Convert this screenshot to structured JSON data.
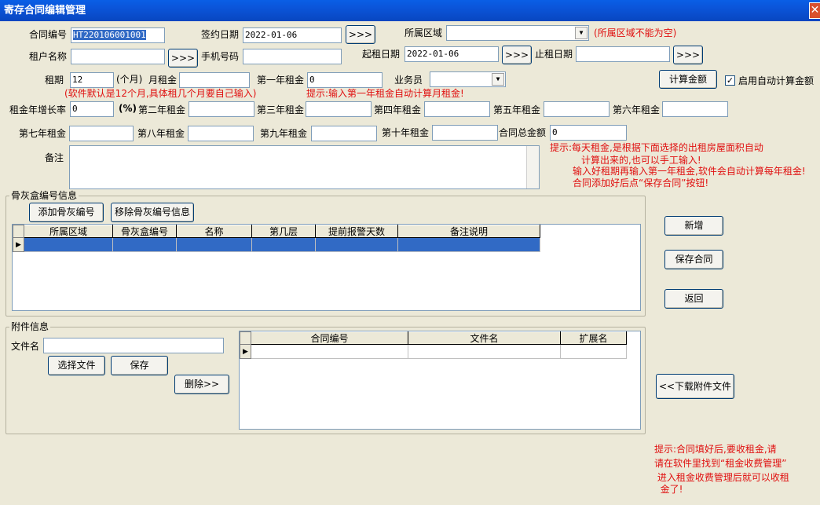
{
  "window": {
    "title": "寄存合同编辑管理",
    "close_glyph": "✕"
  },
  "form": {
    "contract_no_label": "合同编号",
    "contract_no_value": "HT220106001001",
    "sign_date_label": "签约日期",
    "sign_date_value": "2022-01-06",
    "area_label": "所属区域",
    "area_value": "",
    "area_hint": "(所属区域不能为空)",
    "tenant_label": "租户名称",
    "tenant_value": "",
    "phone_label": "手机号码",
    "phone_value": "",
    "start_date_label": "起租日期",
    "start_date_value": "2022-01-06",
    "end_date_label": "止租日期",
    "end_date_value": "",
    "more_button": ">>>",
    "period_label": "租期",
    "period_value": "12",
    "period_unit": "(个月)",
    "monthly_rent_label": "月租金",
    "monthly_rent_value": "",
    "year1_label": "第一年租金",
    "year1_value": "0",
    "salesman_label": "业务员",
    "salesman_value": "",
    "period_hint": "(软件默认是12个月,具体租几个月要自己输入)",
    "year1_hint": "提示:输入第一年租金自动计算月租金!",
    "calc_button": "计算金额",
    "auto_calc_label": "启用自动计算金额",
    "auto_calc_checked": true,
    "growth_label": "租金年增长率",
    "growth_value": "0",
    "growth_unit": "(%)",
    "year2_label": "第二年租金",
    "year3_label": "第三年租金",
    "year4_label": "第四年租金",
    "year5_label": "第五年租金",
    "year6_label": "第六年租金",
    "year7_label": "第七年租金",
    "year8_label": "第八年租金",
    "year9_label": "第九年租金",
    "year10_label": "第十年租金",
    "total_label": "合同总金额",
    "total_value": "0",
    "remark_label": "备注",
    "remark_value": "",
    "rent_hint_lines": [
      "提示:每天租金,是根据下面选择的出租房屋面积自动",
      "计算出来的,也可以手工输入!",
      "输入好租期再输入第一年租金,软件会自动计算每年租金!",
      "合同添加好后点“保存合同”按钮!"
    ]
  },
  "urn_section": {
    "title": "骨灰盒编号信息",
    "add_button": "添加骨灰编号",
    "remove_button": "移除骨灰编号信息",
    "columns": [
      "所属区域",
      "骨灰盒编号",
      "名称",
      "第几层",
      "提前报警天数",
      "备注说明"
    ],
    "row_indicator": "▶"
  },
  "side_buttons": {
    "new": "新增",
    "save_contract": "保存合同",
    "back": "返回",
    "download": "<<下载附件文件"
  },
  "attach_section": {
    "title": "附件信息",
    "filename_label": "文件名",
    "filename_value": "",
    "choose_button": "选择文件",
    "save_button": "保存",
    "delete_button": "删除>>",
    "columns": [
      "合同编号",
      "文件名",
      "扩展名"
    ],
    "row_indicator": "▶"
  },
  "bottom_hint_lines": [
    "提示:合同填好后,要收租金,请",
    "请在软件里找到“租金收费管理”",
    " 进入租金收费管理后就可以收租",
    "  金了!"
  ]
}
